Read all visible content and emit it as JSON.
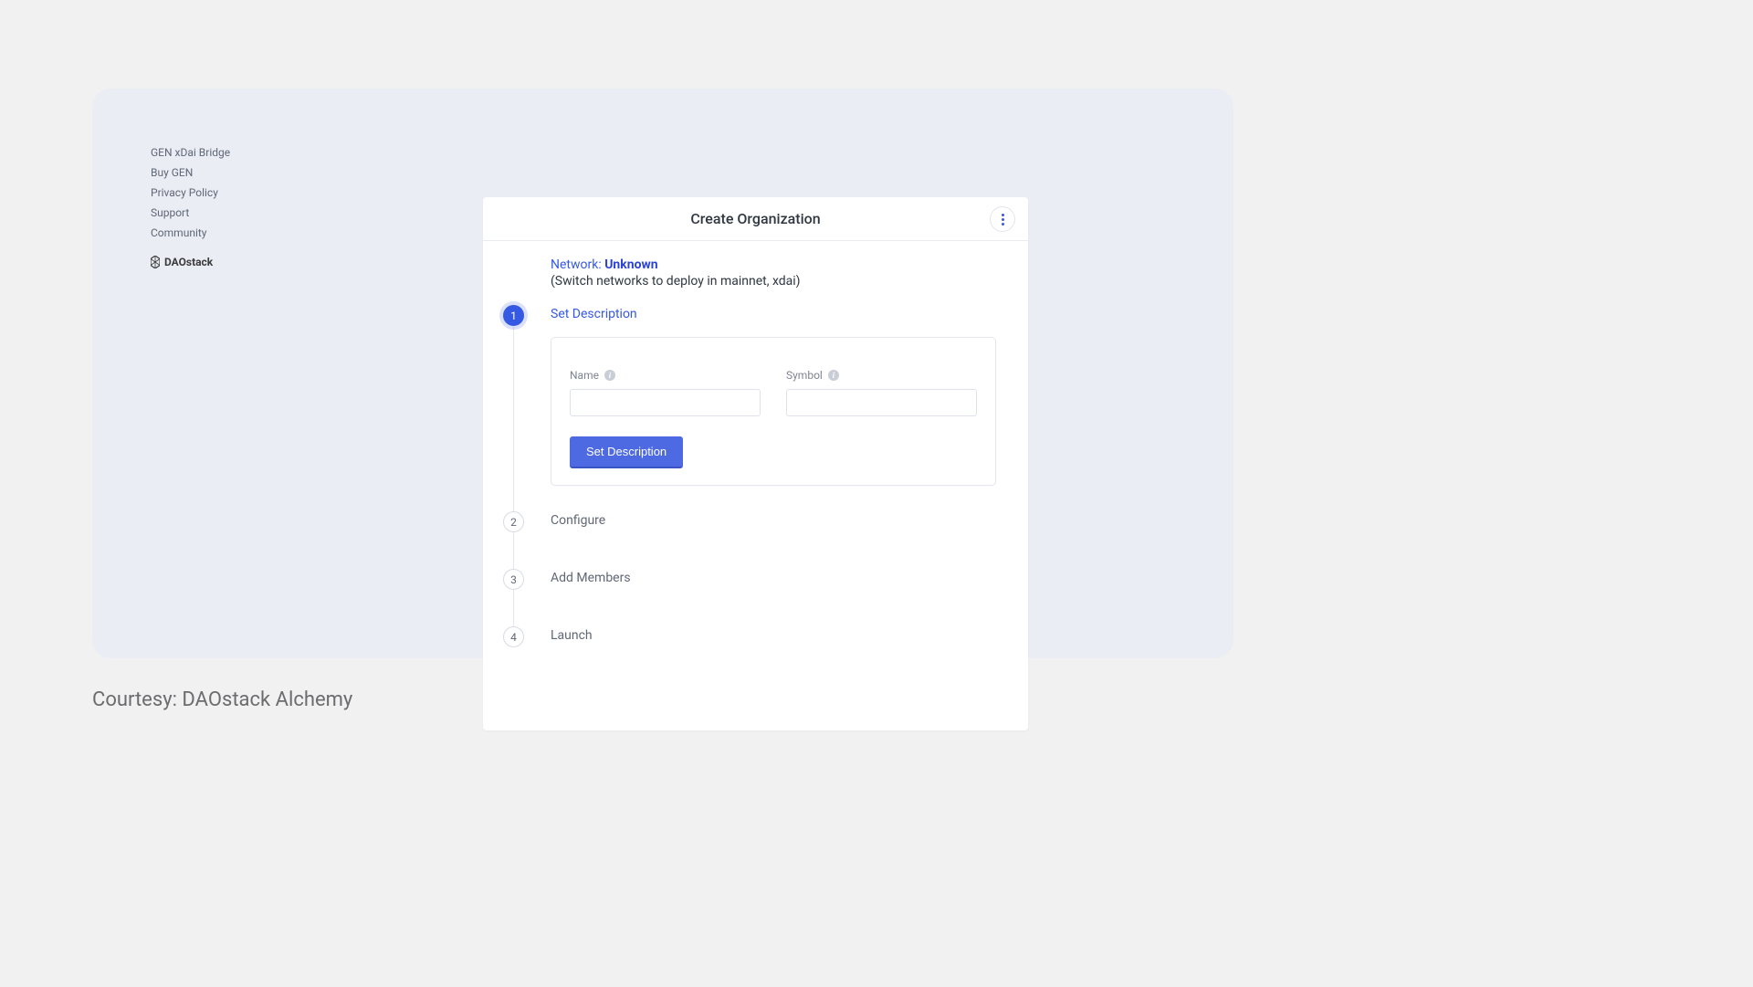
{
  "sidebar": {
    "links": [
      "GEN xDai Bridge",
      "Buy GEN",
      "Privacy Policy",
      "Support",
      "Community"
    ],
    "brand": "DAOstack"
  },
  "panel": {
    "title": "Create Organization",
    "network_label": "Network: ",
    "network_value": "Unknown",
    "network_hint": "(Switch networks to deploy in mainnet, xdai)"
  },
  "steps": [
    {
      "number": "1",
      "title": "Set Description",
      "active": true
    },
    {
      "number": "2",
      "title": "Configure",
      "active": false
    },
    {
      "number": "3",
      "title": "Add Members",
      "active": false
    },
    {
      "number": "4",
      "title": "Launch",
      "active": false
    }
  ],
  "form": {
    "name_label": "Name",
    "symbol_label": "Symbol",
    "submit_label": "Set Description"
  },
  "courtesy": "Courtesy: DAOstack Alchemy"
}
